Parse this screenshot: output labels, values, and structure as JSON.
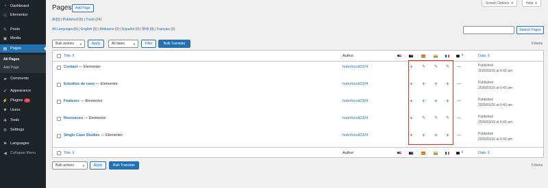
{
  "sidebar": {
    "items": [
      {
        "label": "Dashboard",
        "icon": "dashboard-icon"
      },
      {
        "label": "Elementor",
        "icon": "elementor-icon"
      },
      {
        "label": "Posts",
        "icon": "pushpin-icon"
      },
      {
        "label": "Media",
        "icon": "media-icon"
      },
      {
        "label": "Pages",
        "icon": "pages-icon"
      },
      {
        "label": "Comments",
        "icon": "comments-icon"
      },
      {
        "label": "Appearance",
        "icon": "paintbrush-icon"
      },
      {
        "label": "Plugins",
        "icon": "plugins-icon",
        "badge": "13"
      },
      {
        "label": "Users",
        "icon": "users-icon"
      },
      {
        "label": "Tools",
        "icon": "tools-icon"
      },
      {
        "label": "Settings",
        "icon": "settings-icon"
      },
      {
        "label": "Languages",
        "icon": "languages-icon"
      },
      {
        "label": "Collapse Menu",
        "icon": "collapse-icon"
      }
    ],
    "submenu": {
      "all_pages": "All Pages",
      "add_page": "Add Page"
    }
  },
  "top": {
    "screen_options": "Screen Options",
    "help": "Help"
  },
  "header": {
    "title": "Pages",
    "add_button": "Add Page"
  },
  "views": {
    "all": "All",
    "all_count": "(5)",
    "published": "Published",
    "published_count": "(5)",
    "trash": "Trash",
    "trash_count": "(24)"
  },
  "languages": {
    "all": "All Languages",
    "all_count": "(5)",
    "english": "English",
    "english_count": "(5)",
    "afrikaans": "Afrikaans",
    "afrikaans_count": "(0)",
    "espanol": "Español",
    "espanol_count": "(0)",
    "hindi": "हिन्दी",
    "hindi_count": "(0)",
    "francais": "Français",
    "francais_count": "(0)"
  },
  "search": {
    "button": "Search Pages",
    "value": ""
  },
  "tablenav_top": {
    "bulk_actions": "Bulk actions",
    "apply": "Apply",
    "all_dates": "All dates",
    "filter": "Filter",
    "bulk_translate": "Bulk Translate",
    "items": "5 items"
  },
  "tablenav_bottom": {
    "bulk_actions": "Bulk actions",
    "apply": "Apply",
    "bulk_translate": "Bulk Translate",
    "items": "5 items"
  },
  "table": {
    "col_title": "Title",
    "col_author": "Author",
    "col_date": "Date",
    "rows": [
      {
        "title": "Contact",
        "suffix": " — Elementor",
        "author": "hubofozuli2324",
        "actions": [
          "plus",
          "pencil",
          "pencil",
          "pencil"
        ],
        "dash": "—",
        "status": "Published",
        "date": "2026/03/16 at 6:43 am"
      },
      {
        "title": "Estudios de caso",
        "suffix": " — Elementor",
        "author": "hubofozuli2324",
        "actions": [
          "plus",
          "plus",
          "plus",
          "plus"
        ],
        "dash": "—",
        "status": "Published",
        "date": "2026/03/16 at 6:43 am"
      },
      {
        "title": "Features",
        "suffix": " — Elementor",
        "author": "hubofozuli2324",
        "actions": [
          "plus",
          "plus",
          "plus",
          "plus"
        ],
        "dash": "—",
        "status": "Published",
        "date": "2026/03/16 at 6:43 am"
      },
      {
        "title": "Resources",
        "suffix": " — Elementor",
        "author": "hubofozuli2324",
        "actions": [
          "plus",
          "pencil",
          "pencil",
          "pencil"
        ],
        "dash": "—",
        "status": "Published",
        "date": "2026/03/16 at 6:43 am"
      },
      {
        "title": "Single Case Studies",
        "suffix": " — Elementor",
        "author": "hubofozuli2324",
        "actions": [
          "plus",
          "plus",
          "plus",
          "plus"
        ],
        "dash": "—",
        "status": "Published",
        "date": "2026/03/16 at 6:43 am"
      }
    ],
    "flags": [
      "us-flag-icon",
      "za-flag-icon",
      "es-flag-icon",
      "in-flag-icon",
      "fr-flag-icon"
    ]
  },
  "colors": {
    "accent": "#2271b1",
    "sidebar": "#1d2327",
    "highlight": "#e22d2d",
    "badge": "#d63638"
  }
}
